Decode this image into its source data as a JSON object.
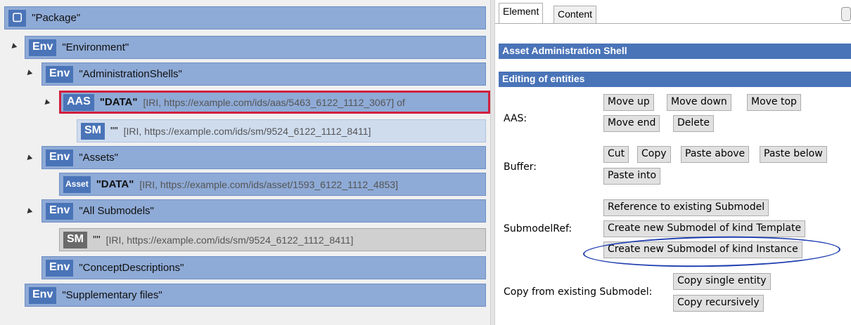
{
  "tree": {
    "nodes": [
      {
        "badge": "▢",
        "title": "\"Package\"",
        "info": ""
      },
      {
        "badge": "Env",
        "title": "\"Environment\"",
        "info": ""
      },
      {
        "badge": "Env",
        "title": "\"AdministrationShells\"",
        "info": ""
      },
      {
        "badge": "AAS",
        "title": "\"DATA\"",
        "info": "[IRI, https://example.com/ids/aas/5463_6122_1112_3067] of"
      },
      {
        "badge": "SM",
        "title": "\"\"",
        "info": "[IRI, https://example.com/ids/sm/9524_6122_1112_8411]"
      },
      {
        "badge": "Env",
        "title": "\"Assets\"",
        "info": ""
      },
      {
        "badge": "Asset",
        "title": "\"DATA\"",
        "info": "[IRI, https://example.com/ids/asset/1593_6122_1112_4853]"
      },
      {
        "badge": "Env",
        "title": "\"All Submodels\"",
        "info": ""
      },
      {
        "badge": "SM",
        "title": "\"\"",
        "info": "[IRI, https://example.com/ids/sm/9524_6122_1112_8411]"
      },
      {
        "badge": "Env",
        "title": "\"ConceptDescriptions\"",
        "info": ""
      },
      {
        "badge": "Env",
        "title": "\"Supplementary files\"",
        "info": ""
      }
    ]
  },
  "tabs": {
    "element": "Element",
    "content": "Content"
  },
  "sections": {
    "aas_header": "Asset Administration Shell",
    "editing_header": "Editing of entities"
  },
  "rows": {
    "aas_label": "AAS:",
    "buffer_label": "Buffer:",
    "submodelref_label": "SubmodelRef:",
    "copy_label": "Copy from existing Submodel:"
  },
  "buttons": {
    "move_up": "Move up",
    "move_down": "Move down",
    "move_top": "Move top",
    "move_end": "Move end",
    "delete": "Delete",
    "cut": "Cut",
    "copy": "Copy",
    "paste_above": "Paste above",
    "paste_below": "Paste below",
    "paste_into": "Paste into",
    "reference_existing": "Reference to existing Submodel",
    "create_template": "Create new Submodel of kind Template",
    "create_instance": "Create new Submodel of kind Instance",
    "copy_single": "Copy single entity",
    "copy_recursive": "Copy recursively"
  },
  "colors": {
    "node_blue": "#8eaad6",
    "badge_blue": "#4a74b8",
    "selection_red": "#d11f3e",
    "annotation_blue": "#1f3fb0"
  }
}
